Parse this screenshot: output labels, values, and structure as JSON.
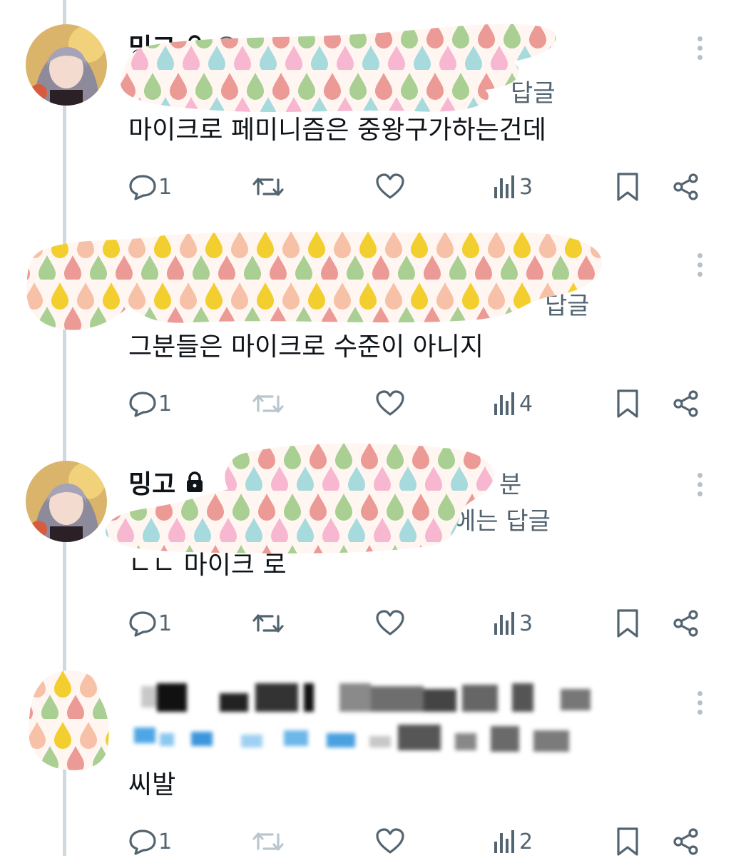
{
  "tweets": [
    {
      "name": "밍고",
      "handle_visible": "@",
      "reply_suffix": "답글",
      "text": "마이크로 페미니즘은 중왕구가하는건데",
      "counts": {
        "replies": "1",
        "views": "3"
      },
      "retweet_enabled": true
    },
    {
      "name": "",
      "handle_visible": "",
      "reply_suffix": "답글",
      "text": "그분들은 마이크로 수준이 아니지",
      "counts": {
        "replies": "1",
        "views": "4"
      },
      "retweet_enabled": false
    },
    {
      "name": "밍고",
      "handle_visible": "",
      "handle_tail": "분",
      "reply_suffix": "에는 답글",
      "text": "ㄴㄴ 마이크 로",
      "counts": {
        "replies": "1",
        "views": "3"
      },
      "retweet_enabled": true
    },
    {
      "name": "",
      "handle_visible": "",
      "reply_suffix": "",
      "text": "씨발",
      "counts": {
        "replies": "1",
        "views": "2"
      },
      "retweet_enabled": false
    }
  ],
  "icons": {
    "reply": "speech-bubble-icon",
    "retweet": "retweet-arrows-icon",
    "like": "heart-icon",
    "views": "bar-chart-icon",
    "bookmark": "bookmark-icon",
    "share": "share-icon",
    "more": "vertical-ellipsis-icon",
    "lock": "lock-icon"
  },
  "colors": {
    "text": "#0f1419",
    "secondary": "#536471",
    "thread_line": "#cfd9de",
    "mention": "#1d9bf0"
  }
}
